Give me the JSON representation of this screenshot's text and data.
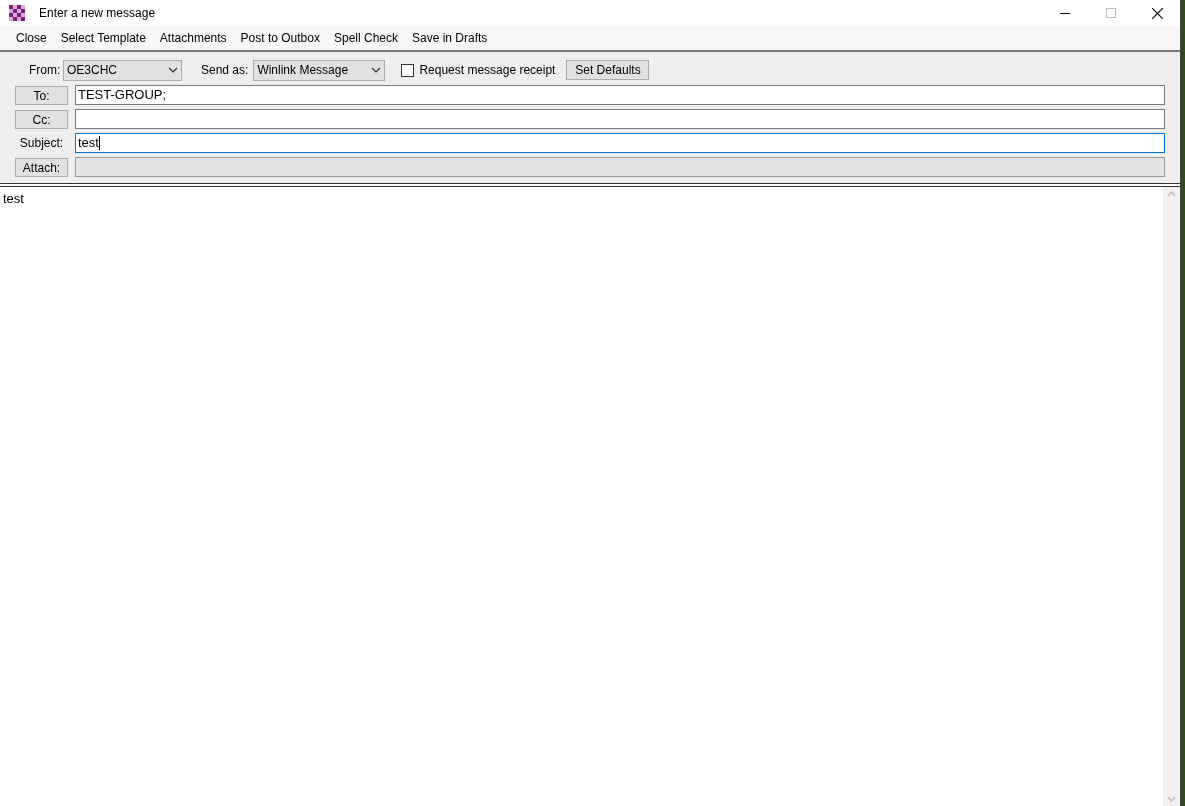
{
  "window": {
    "title": "Enter a new message"
  },
  "menu": [
    "Close",
    "Select Template",
    "Attachments",
    "Post to Outbox",
    "Spell Check",
    "Save in Drafts"
  ],
  "from": {
    "label": "From:",
    "value": "OE3CHC"
  },
  "send_as": {
    "label": "Send as:",
    "value": "Winlink Message"
  },
  "receipt": {
    "label": "Request message receipt",
    "checked": false
  },
  "set_defaults": "Set Defaults",
  "fields": [
    {
      "kind": "button",
      "label": "To:",
      "value": "TEST-GROUP;",
      "focused": false,
      "disabled": false
    },
    {
      "kind": "button",
      "label": "Cc:",
      "focused": false,
      "disabled": false
    },
    {
      "kind": "label",
      "label": "Subject:",
      "value": "test",
      "focused": true,
      "disabled": false
    },
    {
      "kind": "button",
      "label": "Attach:",
      "focused": false,
      "disabled": true
    }
  ],
  "body": "test"
}
